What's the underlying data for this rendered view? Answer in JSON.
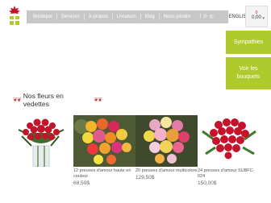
{
  "nav": {
    "items": [
      "Boutique",
      "Services",
      "À propos",
      "Livraison",
      "Blog",
      "Nous joindre"
    ],
    "social_icons": [
      "facebook-icon",
      "pinterest-icon",
      "instagram-icon"
    ],
    "language": "ENGLISH"
  },
  "cart": {
    "amount": "0,00",
    "count": "0"
  },
  "side_buttons": {
    "first": "Sympathies",
    "second": "Voir les bouquets"
  },
  "section_title": "Nos fleurs en vedettes",
  "products": [
    {
      "name": "",
      "price": ""
    },
    {
      "name": "12 preuves d'amour haute en couleur",
      "price": "68,50$"
    },
    {
      "name": "20 preuves d'amour multicolore",
      "price": "129,50$"
    },
    {
      "name": "24 preuves d'amour SUBFC-024",
      "price": "150,00$"
    }
  ],
  "colors": {
    "accent": "#aeca2c",
    "nav_bg": "#c7c7c7",
    "brand_red": "#c8102e"
  }
}
